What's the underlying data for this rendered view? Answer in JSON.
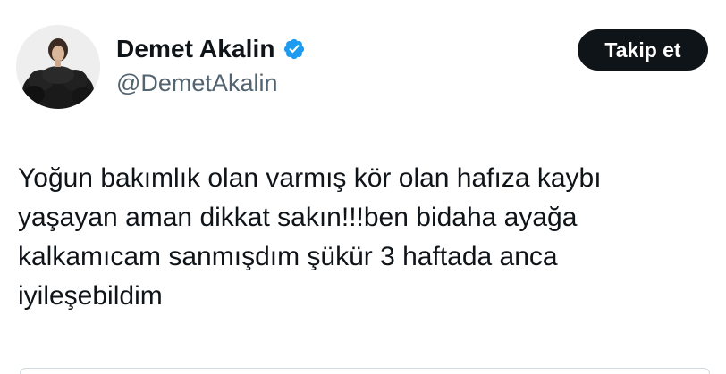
{
  "author": {
    "display_name": "Demet Akalin",
    "handle": "@DemetAkalin",
    "verified": true,
    "avatar_icon": "profile-photo-woman-black-fur"
  },
  "actions": {
    "follow_label": "Takip et"
  },
  "tweet": {
    "text": "Yoğun bakımlık olan varmış kör olan hafıza kaybı\nyaşayan aman dikkat sakın!!!ben bidaha ayağa\nkalkamıcam sanmışdım şükür 3 haftada anca\niyileşebildim"
  },
  "colors": {
    "text_primary": "#0f1419",
    "text_secondary": "#536471",
    "verified_badge": "#1d9bf0",
    "button_bg": "#0f1419",
    "button_text": "#ffffff"
  }
}
